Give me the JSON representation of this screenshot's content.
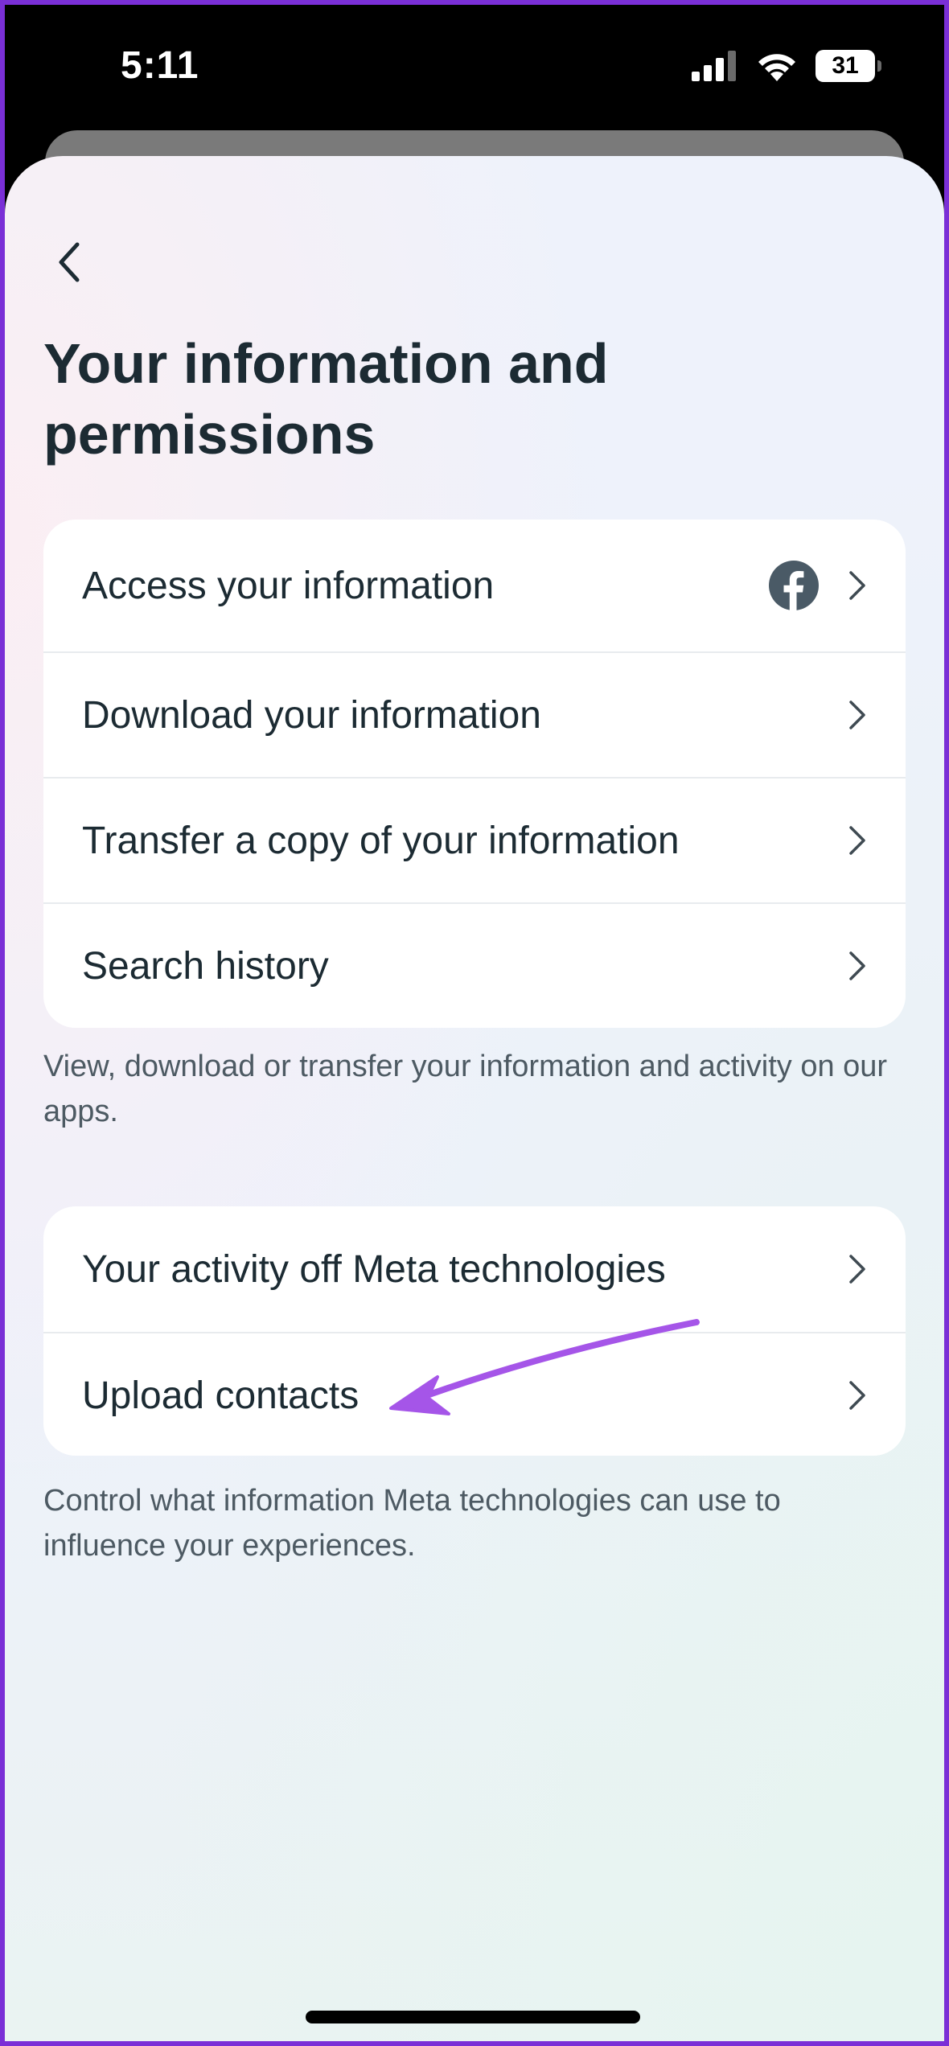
{
  "status_bar": {
    "time": "5:11",
    "battery": "31"
  },
  "page": {
    "title": "Your information and permissions"
  },
  "section_1": {
    "items": [
      {
        "label": "Access your information",
        "icon": "facebook-icon"
      },
      {
        "label": "Download your information"
      },
      {
        "label": "Transfer a copy of your information"
      },
      {
        "label": "Search history"
      }
    ],
    "caption": "View, download or transfer your information and activity on our apps."
  },
  "section_2": {
    "items": [
      {
        "label": "Your activity off Meta technologies"
      },
      {
        "label": "Upload contacts"
      }
    ],
    "caption": "Control what information Meta technologies can use to influence your experiences."
  },
  "colors": {
    "text_primary": "#1c2b33",
    "text_secondary": "#4d5a63",
    "annotation_arrow": "#a555e8",
    "frame_border": "#7a2fd6"
  }
}
